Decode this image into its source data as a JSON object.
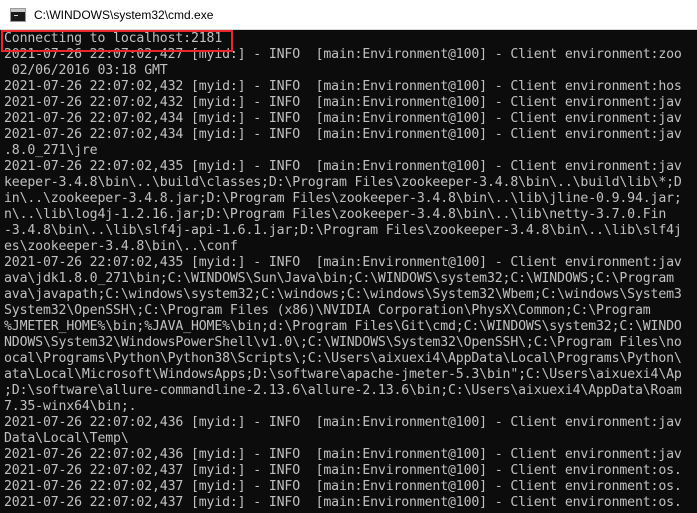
{
  "window": {
    "title": "C:\\WINDOWS\\system32\\cmd.exe",
    "highlight_color": "#e8262c",
    "icon": "cmd-icon"
  },
  "console": {
    "lines": [
      "Connecting to localhost:2181",
      "2021-07-26 22:07:02,427 [myid:] - INFO  [main:Environment@100] - Client environment:zoo",
      " 02/06/2016 03:18 GMT",
      "2021-07-26 22:07:02,432 [myid:] - INFO  [main:Environment@100] - Client environment:hos",
      "2021-07-26 22:07:02,432 [myid:] - INFO  [main:Environment@100] - Client environment:jav",
      "2021-07-26 22:07:02,434 [myid:] - INFO  [main:Environment@100] - Client environment:jav",
      "2021-07-26 22:07:02,434 [myid:] - INFO  [main:Environment@100] - Client environment:jav",
      ".8.0_271\\jre",
      "2021-07-26 22:07:02,435 [myid:] - INFO  [main:Environment@100] - Client environment:jav",
      "keeper-3.4.8\\bin\\..\\build\\classes;D:\\Program Files\\zookeeper-3.4.8\\bin\\..\\build\\lib\\*;D",
      "in\\..\\zookeeper-3.4.8.jar;D:\\Program Files\\zookeeper-3.4.8\\bin\\..\\lib\\jline-0.9.94.jar;",
      "n\\..\\lib\\log4j-1.2.16.jar;D:\\Program Files\\zookeeper-3.4.8\\bin\\..\\lib\\netty-3.7.0.Fin",
      "-3.4.8\\bin\\..\\lib\\slf4j-api-1.6.1.jar;D:\\Program Files\\zookeeper-3.4.8\\bin\\..\\lib\\slf4j",
      "es\\zookeeper-3.4.8\\bin\\..\\conf",
      "2021-07-26 22:07:02,435 [myid:] - INFO  [main:Environment@100] - Client environment:jav",
      "ava\\jdk1.8.0_271\\bin;C:\\WINDOWS\\Sun\\Java\\bin;C:\\WINDOWS\\system32;C:\\WINDOWS;C:\\Program",
      "ava\\javapath;C:\\windows\\system32;C:\\windows;C:\\windows\\System32\\Wbem;C:\\windows\\System3",
      "System32\\OpenSSH\\;C:\\Program Files (x86)\\NVIDIA Corporation\\PhysX\\Common;C:\\Program",
      "%JMETER_HOME%\\bin;%JAVA_HOME%\\bin;d:\\Program Files\\Git\\cmd;C:\\WINDOWS\\system32;C:\\WINDO",
      "NDOWS\\System32\\WindowsPowerShell\\v1.0\\;C:\\WINDOWS\\System32\\OpenSSH\\;C:\\Program Files\\no",
      "ocal\\Programs\\Python\\Python38\\Scripts\\;C:\\Users\\aixuexi4\\AppData\\Local\\Programs\\Python\\",
      "ata\\Local\\Microsoft\\WindowsApps;D:\\software\\apache-jmeter-5.3\\bin\";C:\\Users\\aixuexi4\\Ap",
      ";D:\\software\\allure-commandline-2.13.6\\allure-2.13.6\\bin;C:\\Users\\aixuexi4\\AppData\\Roam",
      "7.35-winx64\\bin;.",
      "2021-07-26 22:07:02,436 [myid:] - INFO  [main:Environment@100] - Client environment:jav",
      "Data\\Local\\Temp\\",
      "2021-07-26 22:07:02,436 [myid:] - INFO  [main:Environment@100] - Client environment:jav",
      "2021-07-26 22:07:02,437 [myid:] - INFO  [main:Environment@100] - Client environment:os.",
      "2021-07-26 22:07:02,437 [myid:] - INFO  [main:Environment@100] - Client environment:os.",
      "2021-07-26 22:07:02,437 [myid:] - INFO  [main:Environment@100] - Client environment:os."
    ]
  }
}
